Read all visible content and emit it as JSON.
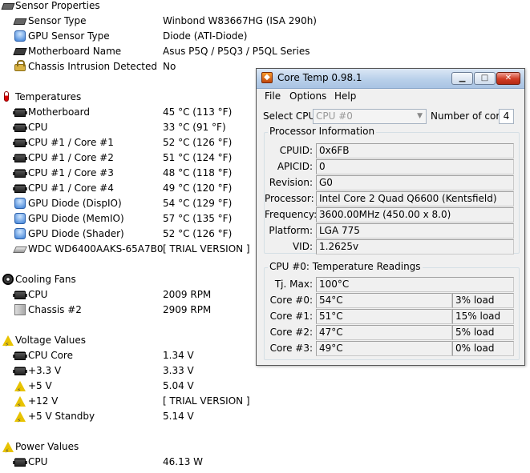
{
  "hwinfo": {
    "sections": [
      {
        "id": "sensor-properties",
        "icon": "sensor",
        "title": "Sensor Properties",
        "items": [
          {
            "icon": "sensor-chip",
            "label": "Sensor Type",
            "value": "Winbond W83667HG  (ISA 290h)"
          },
          {
            "icon": "gpu",
            "label": "GPU Sensor Type",
            "value": "Diode  (ATI-Diode)"
          },
          {
            "icon": "motherboard",
            "label": "Motherboard Name",
            "value": "Asus P5Q / P5Q3 / P5QL Series"
          },
          {
            "icon": "lock",
            "label": "Chassis Intrusion Detected",
            "value": "No"
          }
        ]
      },
      {
        "id": "temperatures",
        "icon": "thermometer",
        "title": "Temperatures",
        "items": [
          {
            "icon": "chip",
            "label": "Motherboard",
            "value": "45 °C  (113 °F)"
          },
          {
            "icon": "chip",
            "label": "CPU",
            "value": "33 °C  (91 °F)"
          },
          {
            "icon": "chip",
            "label": "CPU #1 / Core #1",
            "value": "52 °C  (126 °F)"
          },
          {
            "icon": "chip",
            "label": "CPU #1 / Core #2",
            "value": "51 °C  (124 °F)"
          },
          {
            "icon": "chip",
            "label": "CPU #1 / Core #3",
            "value": "48 °C  (118 °F)"
          },
          {
            "icon": "chip",
            "label": "CPU #1 / Core #4",
            "value": "49 °C  (120 °F)"
          },
          {
            "icon": "gpu",
            "label": "GPU Diode (DispIO)",
            "value": "54 °C  (129 °F)"
          },
          {
            "icon": "gpu",
            "label": "GPU Diode (MemIO)",
            "value": "57 °C  (135 °F)"
          },
          {
            "icon": "gpu",
            "label": "GPU Diode (Shader)",
            "value": "52 °C  (126 °F)"
          },
          {
            "icon": "hdd",
            "label": "WDC WD6400AAKS-65A7B0",
            "value": "[ TRIAL VERSION ]"
          }
        ]
      },
      {
        "id": "cooling-fans",
        "icon": "fan",
        "title": "Cooling Fans",
        "items": [
          {
            "icon": "chip",
            "label": "CPU",
            "value": "2009 RPM"
          },
          {
            "icon": "case",
            "label": "Chassis #2",
            "value": "2909 RPM"
          }
        ]
      },
      {
        "id": "voltage-values",
        "icon": "warning",
        "title": "Voltage Values",
        "items": [
          {
            "icon": "chip",
            "label": "CPU Core",
            "value": "1.34 V"
          },
          {
            "icon": "chip",
            "label": "+3.3 V",
            "value": "3.33 V"
          },
          {
            "icon": "warning",
            "label": "+5 V",
            "value": "5.04 V"
          },
          {
            "icon": "warning",
            "label": "+12 V",
            "value": "[ TRIAL VERSION ]"
          },
          {
            "icon": "warning",
            "label": "+5 V Standby",
            "value": "5.14 V"
          }
        ]
      },
      {
        "id": "power-values",
        "icon": "warning",
        "title": "Power Values",
        "items": [
          {
            "icon": "chip",
            "label": "CPU",
            "value": "46.13 W"
          }
        ]
      }
    ]
  },
  "coretemp": {
    "title": "Core Temp 0.98.1",
    "menu": [
      "File",
      "Options",
      "Help"
    ],
    "select_cpu_label": "Select CPU:",
    "select_cpu_value": "CPU #0",
    "num_cores_label": "Number of cores",
    "num_cores_value": "4",
    "processor_info": {
      "title": "Processor Information",
      "fields": [
        {
          "label": "CPUID:",
          "value": "0x6FB"
        },
        {
          "label": "APICID:",
          "value": "0"
        },
        {
          "label": "Revision:",
          "value": "G0"
        },
        {
          "label": "Processor:",
          "value": "Intel Core 2 Quad Q6600 (Kentsfield)"
        },
        {
          "label": "Frequency:",
          "value": "3600.00MHz (450.00 x 8.0)"
        },
        {
          "label": "Platform:",
          "value": "LGA 775"
        },
        {
          "label": "VID:",
          "value": "1.2625v"
        }
      ]
    },
    "temp_readings": {
      "title": "CPU #0: Temperature Readings",
      "tjmax_label": "Tj. Max:",
      "tjmax_value": "100°C",
      "cores": [
        {
          "label": "Core #0:",
          "temp": "54°C",
          "load": "3% load"
        },
        {
          "label": "Core #1:",
          "temp": "51°C",
          "load": "15% load"
        },
        {
          "label": "Core #2:",
          "temp": "47°C",
          "load": "5% load"
        },
        {
          "label": "Core #3:",
          "temp": "49°C",
          "load": "0% load"
        }
      ]
    }
  }
}
